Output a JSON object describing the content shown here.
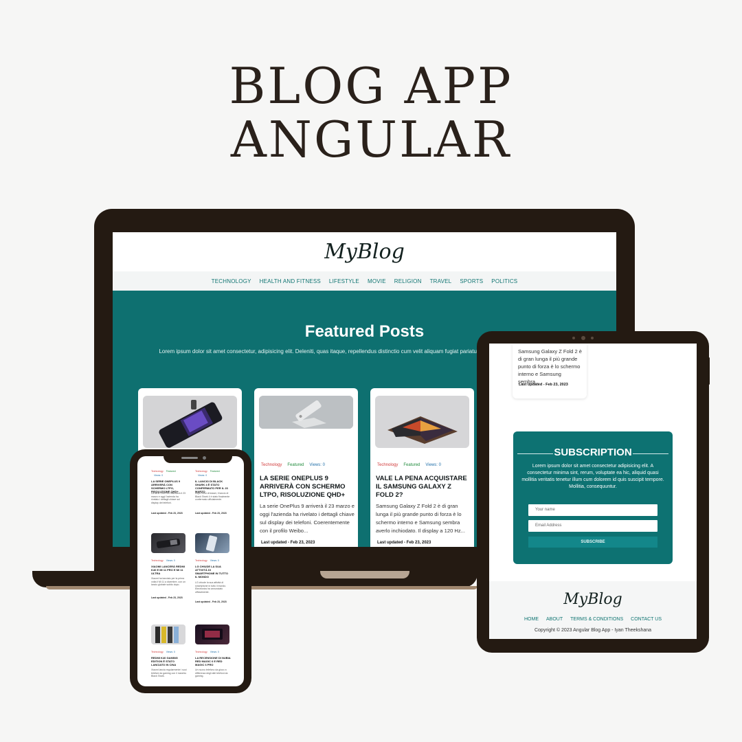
{
  "headline": {
    "line1": "BLOG APP",
    "line2": "ANGULAR"
  },
  "laptop": {
    "logo": "MyBlog",
    "nav": [
      "TECHNOLOGY",
      "HEALTH AND FITNESS",
      "LIFESTYLE",
      "MOVIE",
      "RELIGION",
      "TRAVEL",
      "SPORTS",
      "POLITICS"
    ],
    "hero": {
      "title": "Featured Posts",
      "description": "Lorem ipsum dolor sit amet consectetur, adipisicing elit. Deleniti, quas itaque, repellendus distinctio cum velit aliquam fugiat pariatur qui quia! Rem tenetur dolores omnis."
    },
    "cards": [
      {
        "tags": [
          "Technology",
          "Featured",
          "Views: 0"
        ],
        "title": "La serie OnePlus 9 arriverà con schermo LTPO, risoluzione QHD+",
        "text": "La serie OnePlus 9 arriverà il 23 marzo e oggi l'azienda ha rivelato i dettagli chiave sul display dei telefoni. Coerentemente con il profilo Weibo...",
        "date": "Last updated - Feb 23, 2023"
      },
      {
        "tags": [
          "Technology",
          "Featured",
          "Views: 0"
        ],
        "title": "Vale la pena acquistare il Samsung Galaxy Z Fold 2?",
        "text": "Samsung Galaxy Z Fold 2 è di gran lunga il più grande punto di forza è lo schermo interno e Samsung sembra averlo inchiodato. Il display a 120 Hz...",
        "date": "Last updated - Feb 23, 2023"
      }
    ]
  },
  "tablet": {
    "top_card": {
      "text": "Samsung Galaxy Z Fold 2 è di gran lunga il più grande punto di forza è lo schermo interno e Samsung sembra...",
      "date": "Last updated - Feb 23, 2023"
    },
    "subscription": {
      "title": "SUBSCRIPTION",
      "description": "Lorem ipsum dolor sit amet consectetur adipisicing elit. A consectetur minima sint, rerum, voluptate ea hic, aliquid quasi mollitia veritatis tenetur illum cum dolorem id quis suscipit tempore. Mollitia, consequuntur.",
      "name_placeholder": "Your name",
      "email_placeholder": "Email Address",
      "button": "SUBSCRIBE"
    },
    "footer": {
      "logo": "MyBlog",
      "links": [
        "HOME",
        "ABOUT",
        "TERMS & CONDITIONS",
        "CONTACT US"
      ],
      "copyright": "Copyright © 2023 Angular Blog App - Iyan Theekshana"
    }
  },
  "phone": {
    "cards": [
      {
        "tags": [
          "Technology",
          "Featured",
          "Views: 0"
        ],
        "title": "La serie OnePlus 9 arriverà con schermo LTPO, risoluzione QHD+",
        "text": "La serie OnePlus 9 arriverà il 23 marzo e oggi l'azienda ha rivelato i dettagli chiave sul display dei telefoni.",
        "date": "Last updated - Feb 23, 2023"
      },
      {
        "tags": [
          "Technology",
          "Featured",
          "Views: 0"
        ],
        "title": "Il lancio di Black Shark 4 è stato confermato per il 23 marzo",
        "text": "Dopo mesi di teaser, il lancio di Black Shark 4 è stato finalmente confermato ufficialmente.",
        "date": "Last updated - Feb 23, 2023"
      },
      {
        "tags": [
          "Technology",
          "Views: 0"
        ],
        "title": "Xiaomi lancerà Redmi K40 e Mi 11 Pro e Mi 11 Ultra",
        "text": "Xiaomi ha lanciato per la prima volta il Mi 11 a dicembre, con un lancio globale subito dopo.",
        "date": "Last updated - Feb 23, 2023"
      },
      {
        "tags": [
          "Technology",
          "Views: 0"
        ],
        "title": "LG chiude la sua attività di smartphone in tutto il mondo",
        "text": "LG chiude la sua attività di smartphone in tutto il mondo. Electronics ha annunciato ufficialmente.",
        "date": "Last updated - Feb 23, 2023"
      },
      {
        "tags": [
          "Technology",
          "Views: 0"
        ],
        "title": "Redmi K40 Gaming Edition è stato lanciato in Cina",
        "text": "Xiaomi lancia regolarmente i suoi telefoni da gaming con il marchio Black Shark.",
        "date": ""
      },
      {
        "tags": [
          "Technology",
          "Views: 0"
        ],
        "title": "La recensione di Nubia Red Magic 6 e Red Magic 6 Pro",
        "text": "Un nuovo telefono da gioco a differenza degli altri telefoni da gaming.",
        "date": ""
      }
    ]
  },
  "colors": {
    "teal": "#0e7070",
    "frame": "#241a12",
    "accent_text": "#0f7471"
  }
}
